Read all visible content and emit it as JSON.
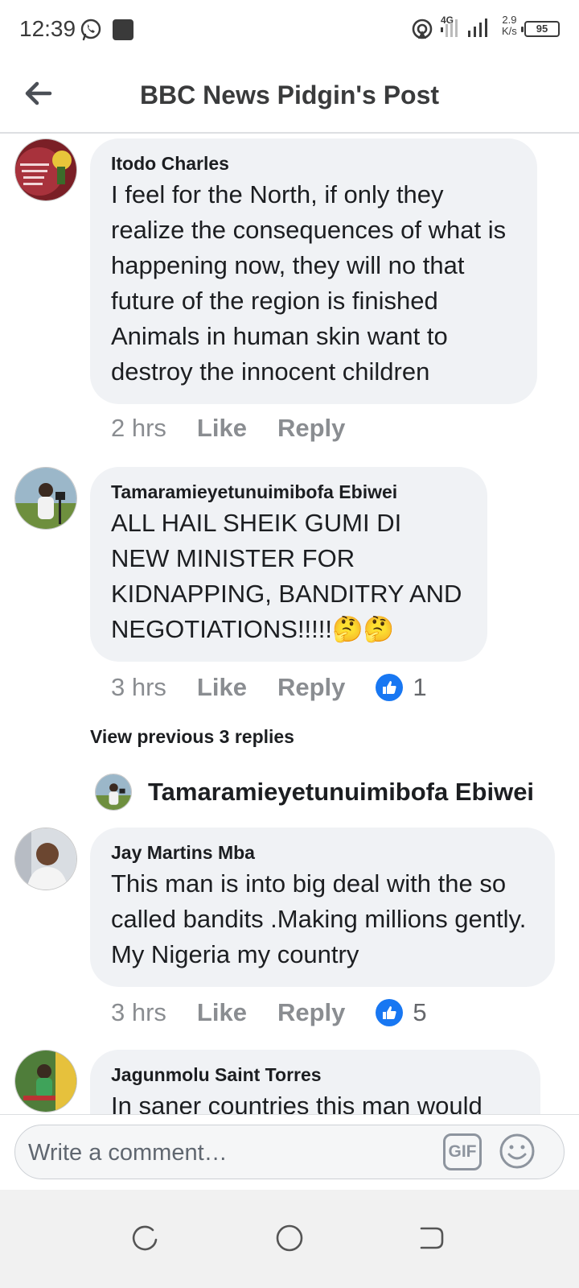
{
  "status_bar": {
    "time": "12:39",
    "network": "4G",
    "speed_value": "2.9",
    "speed_unit": "K/s",
    "battery": "95"
  },
  "header": {
    "title": "BBC News Pidgin's Post"
  },
  "comments": [
    {
      "name": "Itodo Charles",
      "text": "I feel for the North, if only they realize the consequences of what is happening now, they will no that future of the region is finished Animals in human skin want to destroy the innocent children",
      "time": "2 hrs",
      "like_label": "Like",
      "reply_label": "Reply",
      "reactions": ""
    },
    {
      "name": "Tamaramieyetunuimibofa Ebiwei",
      "text": "ALL HAIL SHEIK GUMI DI NEW MINISTER FOR KIDNAPPING, BANDITRY AND NEGOTIATIONS!!!!!🤔🤔",
      "time": "3 hrs",
      "like_label": "Like",
      "reply_label": "Reply",
      "reactions": "1"
    },
    {
      "name": "Jay Martins Mba",
      "text": "This man is into big deal with the so called bandits .Making millions gently. My Nigeria my country",
      "time": "3 hrs",
      "like_label": "Like",
      "reply_label": "Reply",
      "reactions": "5"
    },
    {
      "name": "Jagunmolu Saint Torres",
      "text": "In saner countries this man would"
    }
  ],
  "replies_thread": {
    "view_previous": "View previous 3 replies",
    "latest_reply_name": "Tamaramieyetunuimibofa Ebiwei"
  },
  "composer": {
    "placeholder": "Write a comment…",
    "gif_label": "GIF"
  },
  "colors": {
    "like_blue": "#1877f2",
    "bubble_bg": "#f0f2f5",
    "meta_gray": "#8a8d91"
  }
}
